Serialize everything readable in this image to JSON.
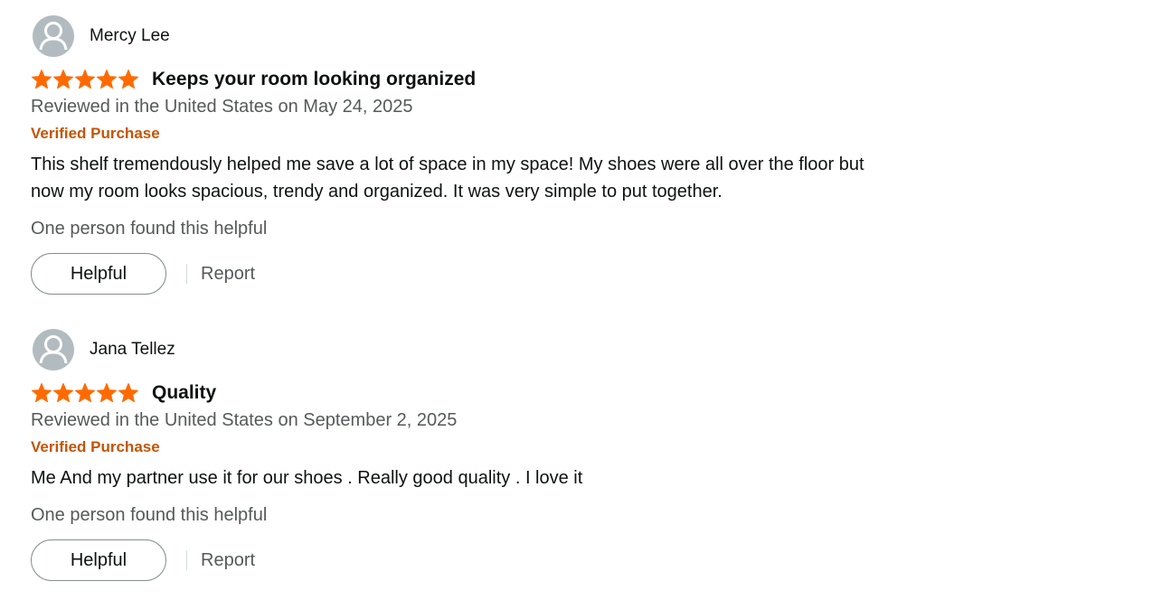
{
  "reviews": [
    {
      "reviewer": "Mercy Lee",
      "rating": 5,
      "rating_max": 5,
      "title": "Keeps your room looking organized",
      "date_line": "Reviewed in the United States on May 24, 2025",
      "badge": "Verified Purchase",
      "body_lines": [
        "This shelf tremendously helped me save a lot of space in my space! My shoes were all over the floor but",
        "now my room looks spacious, trendy and organized. It was very simple to put together."
      ],
      "helpful_text": "One person found this helpful",
      "helpful_label": "Helpful",
      "report_label": "Report"
    },
    {
      "reviewer": "Jana Tellez",
      "rating": 5,
      "rating_max": 5,
      "title": "Quality",
      "date_line": "Reviewed in the United States on September 2, 2025",
      "badge": "Verified Purchase",
      "body_lines": [
        "Me And my partner use it for our shoes . Really good quality . I love it"
      ],
      "helpful_text": "One person found this helpful",
      "helpful_label": "Helpful",
      "report_label": "Report"
    }
  ],
  "colors": {
    "star": "#ff6a00",
    "verified": "#c45500",
    "avatar_bg": "#b2bcc0",
    "secondary_text": "#565959"
  },
  "icons": {
    "avatar": "user-silhouette-icon",
    "star": "star-icon"
  }
}
